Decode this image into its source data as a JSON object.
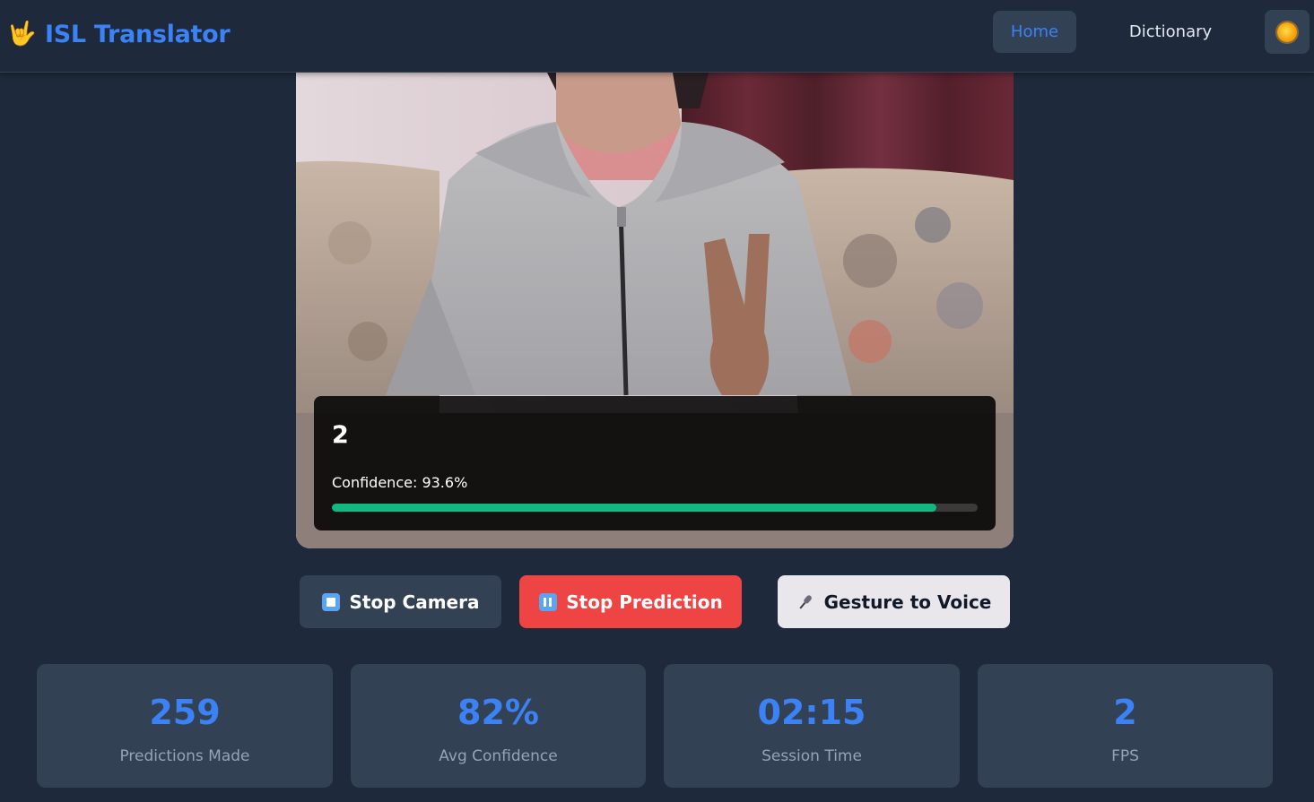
{
  "header": {
    "logo_icon": "🤟",
    "title": "ISL Translator",
    "nav": {
      "home": "Home",
      "dictionary": "Dictionary"
    },
    "theme_icon": "sun-icon"
  },
  "video": {
    "prediction": "2",
    "confidence_text": "Confidence: 93.6%",
    "confidence_fraction": 0.936
  },
  "controls": {
    "stop_camera": "Stop Camera",
    "stop_prediction": "Stop Prediction",
    "gesture_to_voice": "Gesture to Voice"
  },
  "stats": [
    {
      "value": "259",
      "label": "Predictions Made"
    },
    {
      "value": "82%",
      "label": "Avg Confidence"
    },
    {
      "value": "02:15",
      "label": "Session Time"
    },
    {
      "value": "2",
      "label": "FPS"
    }
  ],
  "colors": {
    "accent": "#3b82f6",
    "danger": "#ef4444",
    "success": "#10b981",
    "background": "#1e293b",
    "card": "#334155"
  }
}
